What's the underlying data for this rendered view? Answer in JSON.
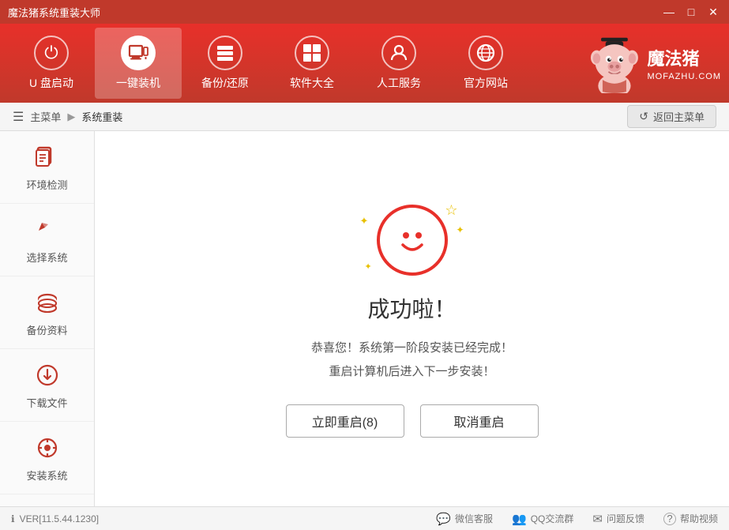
{
  "titlebar": {
    "title": "魔法猪系统重装大师",
    "min_label": "—",
    "max_label": "□",
    "close_label": "✕"
  },
  "topnav": {
    "items": [
      {
        "id": "usb",
        "label": "U 盘启动",
        "icon": "⏻",
        "active": false
      },
      {
        "id": "reinstall",
        "label": "一键装机",
        "icon": "🖥",
        "active": true
      },
      {
        "id": "backup",
        "label": "备份/还原",
        "icon": "☰",
        "active": false
      },
      {
        "id": "software",
        "label": "软件大全",
        "icon": "⊞",
        "active": false
      },
      {
        "id": "service",
        "label": "人工服务",
        "icon": "👤",
        "active": false
      },
      {
        "id": "website",
        "label": "官方网站",
        "icon": "◎",
        "active": false
      }
    ],
    "brand": {
      "cn": "魔法猪",
      "en": "MOFAZHU.COM"
    }
  },
  "breadcrumb": {
    "home": "主菜单",
    "current": "系统重装",
    "back_label": "返回主菜单"
  },
  "sidebar": {
    "items": [
      {
        "id": "env-check",
        "label": "环境检测",
        "icon": "❐"
      },
      {
        "id": "select-os",
        "label": "选择系统",
        "icon": "↖"
      },
      {
        "id": "backup",
        "label": "备份资料",
        "icon": "◉"
      },
      {
        "id": "download",
        "label": "下载文件",
        "icon": "⬇"
      },
      {
        "id": "install",
        "label": "安装系统",
        "icon": "⚙"
      }
    ]
  },
  "content": {
    "success_title": "成功啦！",
    "message_line1": "恭喜您！系统第一阶段安装已经完成！",
    "message_line2": "重启计算机后进入下一步安装！",
    "btn_restart_label": "立即重启(8)",
    "btn_cancel_label": "取消重启"
  },
  "footer": {
    "version": "VER[11.5.44.1230]",
    "items": [
      {
        "id": "wechat",
        "label": "微信客服",
        "icon": "💬"
      },
      {
        "id": "qq",
        "label": "QQ交流群",
        "icon": "👥"
      },
      {
        "id": "feedback",
        "label": "问题反馈",
        "icon": "✉"
      },
      {
        "id": "help",
        "label": "帮助视频",
        "icon": "?"
      }
    ]
  }
}
